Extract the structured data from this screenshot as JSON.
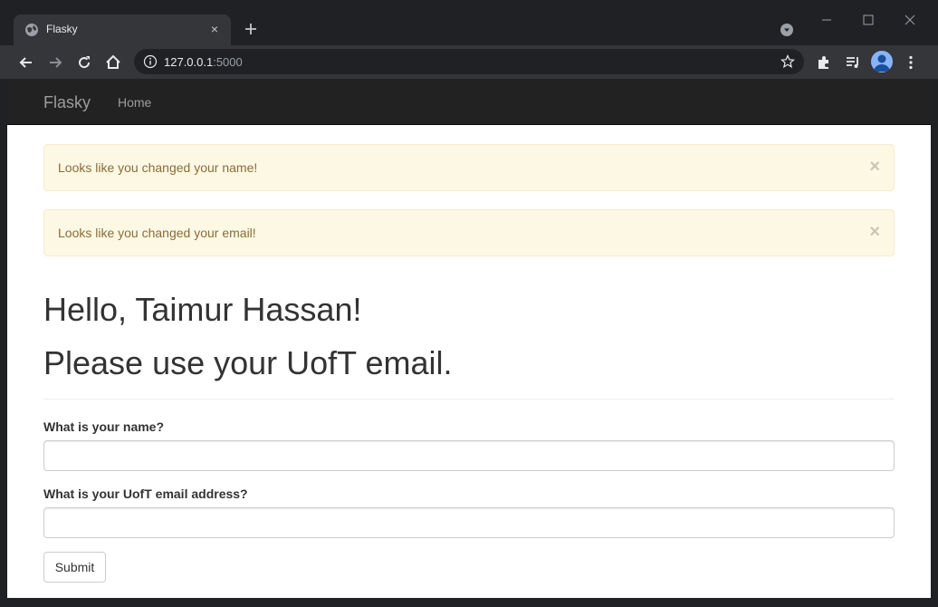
{
  "browser": {
    "tab_title": "Flasky",
    "url_host": "127.0.0.1",
    "url_port": ":5000",
    "tab_close_glyph": "×",
    "icons": [
      "globe-icon",
      "close-icon",
      "plus-icon",
      "chevron-down-icon",
      "minimize-icon",
      "maximize-icon",
      "close-window-icon",
      "back-arrow-icon",
      "forward-arrow-icon",
      "reload-icon",
      "home-icon",
      "info-icon",
      "star-icon",
      "puzzle-icon",
      "media-icon",
      "avatar",
      "kebab-menu-icon"
    ]
  },
  "navbar": {
    "brand": "Flasky",
    "home_label": "Home"
  },
  "alerts": [
    {
      "text": "Looks like you changed your name!",
      "close": "×"
    },
    {
      "text": "Looks like you changed your email!",
      "close": "×"
    }
  ],
  "page": {
    "greeting": "Hello, Taimur Hassan!",
    "notice": "Please use your UofT email."
  },
  "form": {
    "name_label": "What is your name?",
    "name_value": "",
    "email_label": "What is your UofT email address?",
    "email_value": "",
    "submit_label": "Submit"
  },
  "colors": {
    "chrome_dark": "#202124",
    "toolbar": "#35363a",
    "navbar": "#222222",
    "alert_bg": "#fcf8e3",
    "alert_text": "#8a6d3b"
  }
}
